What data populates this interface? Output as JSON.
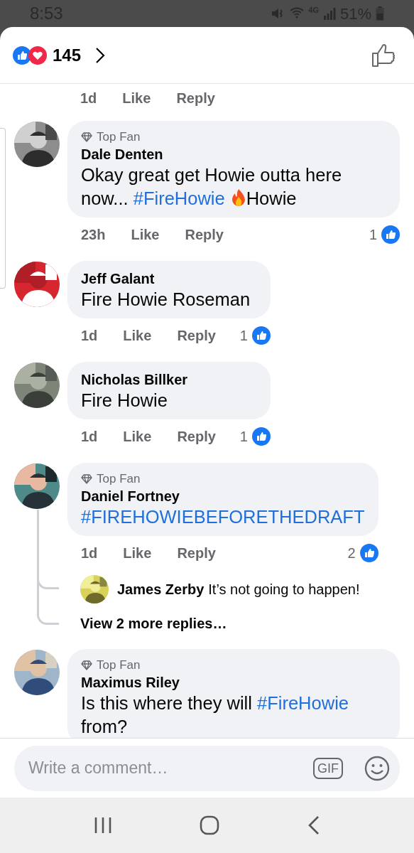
{
  "status_bar": {
    "time": "8:53",
    "network": "4G",
    "battery": "51%"
  },
  "header": {
    "reaction_count": "145"
  },
  "cut_off_meta": {
    "time": "1d",
    "like": "Like",
    "reply": "Reply"
  },
  "comments": [
    {
      "badge": "Top Fan",
      "name": "Dale Denten",
      "body": [
        {
          "kind": "text",
          "text": "Okay great get Howie outta here now... "
        },
        {
          "kind": "hashtag",
          "text": "#FireHowie"
        },
        {
          "kind": "fire"
        },
        {
          "kind": "text",
          "text": "Howie"
        }
      ],
      "time": "23h",
      "like": "Like",
      "reply": "Reply",
      "reactions": "1"
    },
    {
      "name": "Jeff Galant",
      "body": [
        {
          "kind": "text",
          "text": "Fire Howie Roseman"
        }
      ],
      "time": "1d",
      "like": "Like",
      "reply": "Reply",
      "reactions": "1"
    },
    {
      "name": "Nicholas Billker",
      "body": [
        {
          "kind": "text",
          "text": "Fire Howie"
        }
      ],
      "time": "1d",
      "like": "Like",
      "reply": "Reply",
      "reactions": "1"
    },
    {
      "badge": "Top Fan",
      "name": "Daniel Fortney",
      "body": [
        {
          "kind": "hashtag",
          "text": "#FIREHOWIEBEFORETHEDRAFT"
        }
      ],
      "time": "1d",
      "like": "Like",
      "reply": "Reply",
      "reactions": "2",
      "replies": [
        {
          "name": "James Zerby",
          "text": "It’s not going to happen!"
        }
      ],
      "more_replies": "View 2 more replies…"
    },
    {
      "badge": "Top Fan",
      "name": "Maximus Riley",
      "body": [
        {
          "kind": "text",
          "text": "Is this where they will "
        },
        {
          "kind": "hashtag",
          "text": "#FireHowie"
        },
        {
          "kind": "text",
          "text": " from?"
        }
      ]
    }
  ],
  "composer": {
    "placeholder": "Write a comment…",
    "gif": "GIF"
  }
}
